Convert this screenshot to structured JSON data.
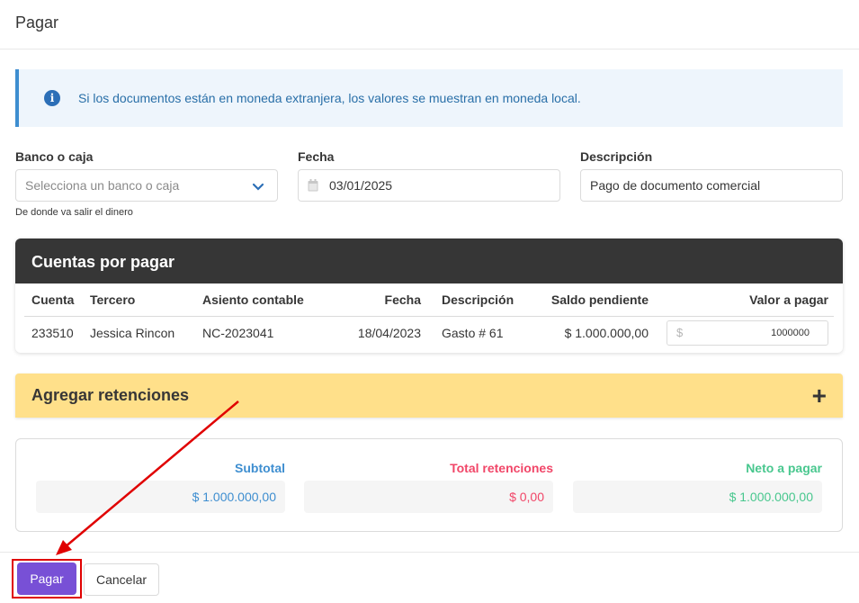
{
  "header": {
    "title": "Pagar"
  },
  "notice": {
    "text": "Si los documentos están en moneda extranjera, los valores se muestran en moneda local."
  },
  "form": {
    "bank": {
      "label": "Banco o caja",
      "placeholder": "Selecciona un banco o caja",
      "help": "De donde va salir el dinero"
    },
    "date": {
      "label": "Fecha",
      "value": "03/01/2025"
    },
    "description": {
      "label": "Descripción",
      "value": "Pago de documento comercial"
    }
  },
  "payables": {
    "title": "Cuentas por pagar",
    "columns": [
      "Cuenta",
      "Tercero",
      "Asiento contable",
      "Fecha",
      "Descripción",
      "Saldo pendiente",
      "Valor a pagar"
    ],
    "rows": [
      {
        "cuenta": "233510",
        "tercero": "Jessica Rincon",
        "asiento": "NC-2023041",
        "fecha": "18/04/2023",
        "descripcion": "Gasto # 61",
        "saldo": "$ 1.000.000,00",
        "currency_prefix": "$",
        "valor": "1000000"
      }
    ]
  },
  "retentions": {
    "title": "Agregar retenciones",
    "icon": "plus-icon"
  },
  "totals": {
    "subtotal": {
      "label": "Subtotal",
      "value": "$ 1.000.000,00"
    },
    "retenciones": {
      "label": "Total retenciones",
      "value": "$ 0,00"
    },
    "neto": {
      "label": "Neto a pagar",
      "value": "$ 1.000.000,00"
    }
  },
  "footer": {
    "pay_label": "Pagar",
    "cancel_label": "Cancelar"
  },
  "colors": {
    "accent": "#7850d6",
    "info": "#3e8ed0",
    "danger": "#f14668",
    "success": "#48c78e",
    "warning": "#ffe08a",
    "annotation": "#e00000"
  }
}
